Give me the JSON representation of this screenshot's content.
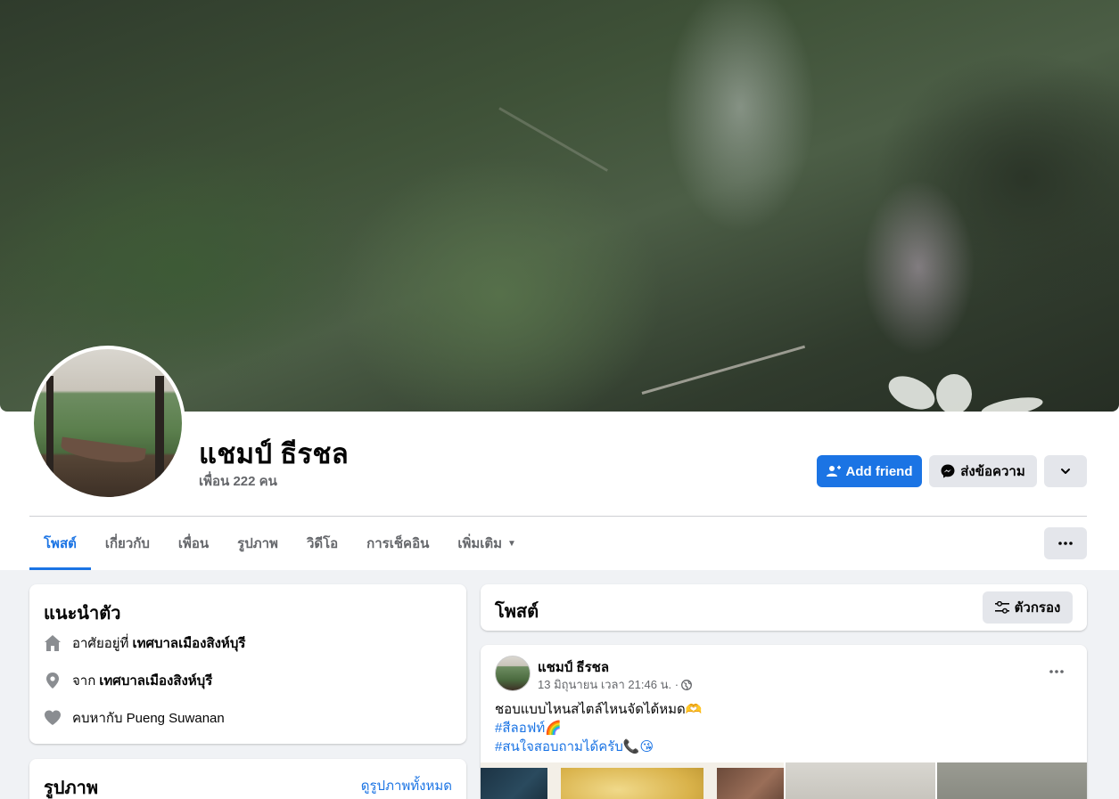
{
  "profile": {
    "name": "แชมป์ ธีรชล",
    "friend_count": "เพื่อน 222 คน"
  },
  "actions": {
    "add_friend": "Add friend",
    "message": "ส่งข้อความ"
  },
  "tabs": [
    {
      "label": "โพสต์"
    },
    {
      "label": "เกี่ยวกับ"
    },
    {
      "label": "เพื่อน"
    },
    {
      "label": "รูปภาพ"
    },
    {
      "label": "วิดีโอ"
    },
    {
      "label": "การเช็คอิน"
    },
    {
      "label": "เพิ่มเติม"
    }
  ],
  "intro": {
    "title": "แนะนำตัว",
    "lives_prefix": "อาศัยอยู่ที่",
    "lives_place": "เทศบาลเมืองสิงห์บุรี",
    "from_prefix": "จาก",
    "from_place": "เทศบาลเมืองสิงห์บุรี",
    "relationship": "คบหากับ Pueng Suwanan"
  },
  "photos": {
    "title": "รูปภาพ",
    "see_all": "ดูรูปภาพทั้งหมด"
  },
  "posts_header": {
    "title": "โพสต์",
    "filter": "ตัวกรอง"
  },
  "post": {
    "author": "แชมป์ ธีรชล",
    "timestamp": "13 มิถุนายน เวลา 21:46 น. ·",
    "line1": "ชอบแบบไหนสไตล์ไหนจัดได้หมด🫶",
    "line2": "#สีลอฟท์🌈",
    "line3": "#สนใจสอบถามได้ครับ📞😘"
  },
  "colors": {
    "accent": "#1b74e4",
    "page_bg": "#f0f2f5",
    "secondary_button": "#e4e6eb",
    "muted_text": "#65676b"
  }
}
